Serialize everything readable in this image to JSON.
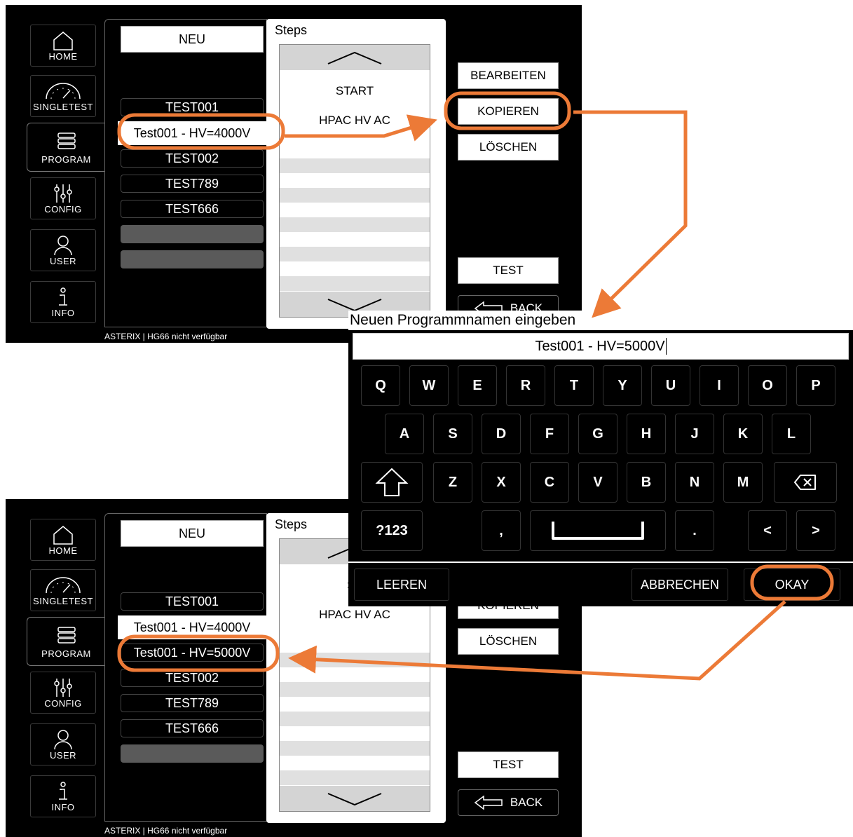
{
  "nav": {
    "home": "HOME",
    "singletest": "SINGLETEST",
    "program": "PROGRAM",
    "config": "CONFIG",
    "user": "USER",
    "info": "INFO"
  },
  "screen1": {
    "neu": "NEU",
    "programs": [
      "TEST001",
      "Test001 - HV=4000V",
      "TEST002",
      "TEST789",
      "TEST666"
    ],
    "steps_title": "Steps",
    "steps": [
      "START",
      "HPAC HV AC"
    ],
    "buttons": {
      "bearbeiten": "BEARBEITEN",
      "kopieren": "KOPIEREN",
      "loeschen": "LÖSCHEN",
      "test": "TEST",
      "back": "BACK"
    },
    "status": "ASTERIX | HG66 nicht verfügbar"
  },
  "screen2": {
    "neu": "NEU",
    "programs": [
      "TEST001",
      "Test001 - HV=4000V",
      "Test001 - HV=5000V",
      "TEST002",
      "TEST789",
      "TEST666"
    ],
    "steps_title": "Steps",
    "steps": [
      "ST",
      "HPAC HV AC"
    ],
    "buttons": {
      "kopieren": "KOPIEREN",
      "loeschen": "LÖSCHEN",
      "test": "TEST",
      "back": "BACK"
    },
    "status": "ASTERIX | HG66 nicht verfügbar"
  },
  "keyboard": {
    "title": "Neuen Programmnamen eingeben",
    "input_value": "Test001 - HV=5000V",
    "row1": [
      "Q",
      "W",
      "E",
      "R",
      "T",
      "Y",
      "U",
      "I",
      "O",
      "P"
    ],
    "row2": [
      "A",
      "S",
      "D",
      "F",
      "G",
      "H",
      "J",
      "K",
      "L"
    ],
    "row3": [
      "Z",
      "X",
      "C",
      "V",
      "B",
      "N",
      "M"
    ],
    "symbols_key": "?123",
    "comma_key": ",",
    "period_key": ".",
    "left_key": "<",
    "right_key": ">",
    "leeren": "LEEREN",
    "abbrechen": "ABBRECHEN",
    "okay": "OKAY"
  },
  "colors": {
    "highlight": "#ec7a37",
    "background": "#000000",
    "panel": "#ffffff"
  }
}
